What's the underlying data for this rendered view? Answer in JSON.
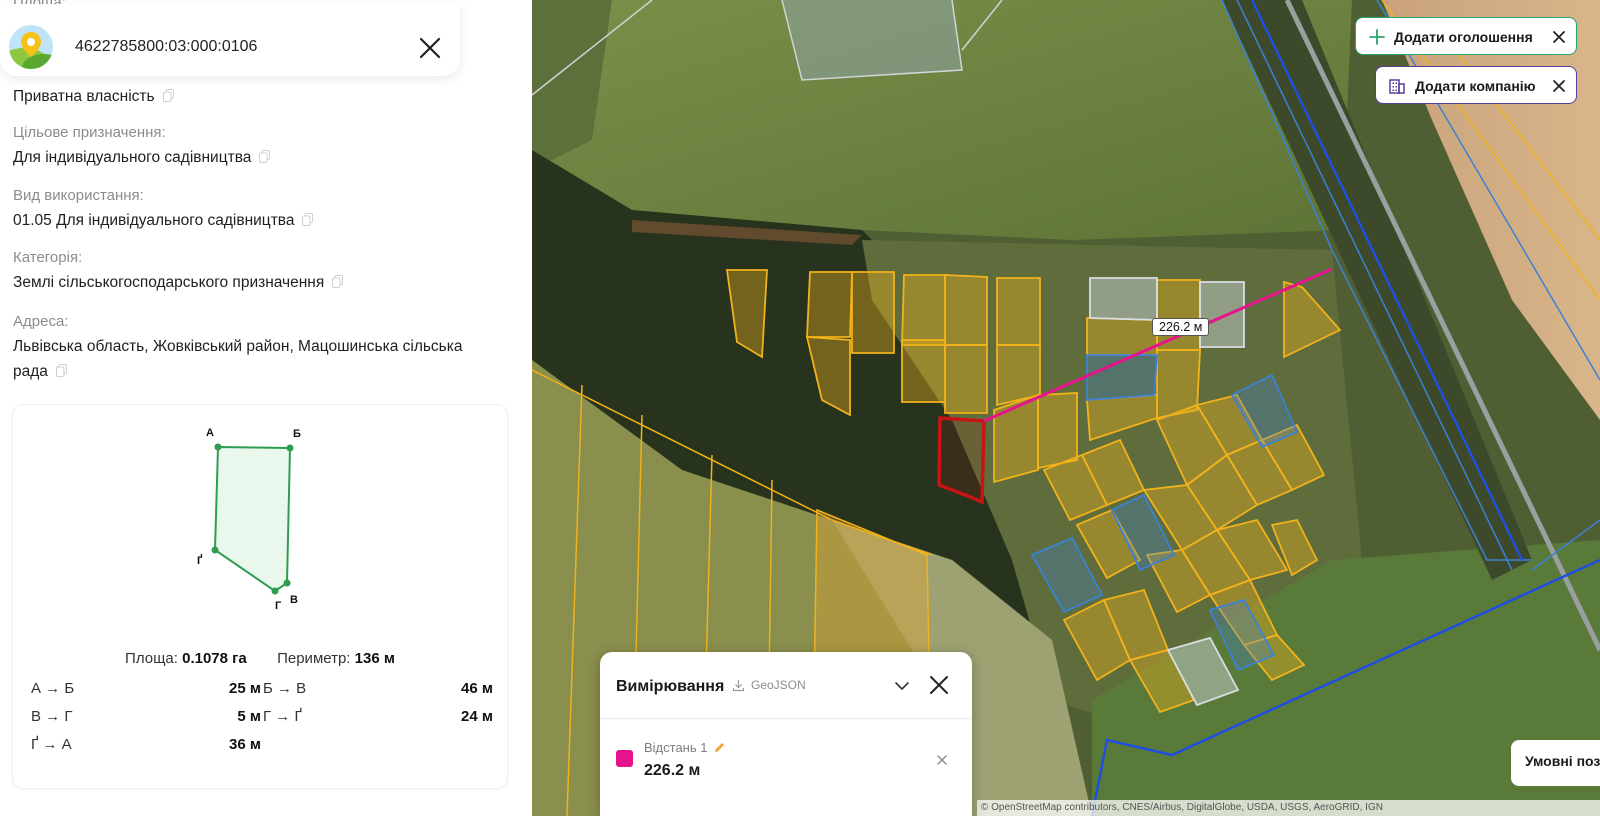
{
  "parcel": {
    "cut_label": "Площа:",
    "cadastral_number": "4622785800:03:000:0106"
  },
  "fields": {
    "ownership_value": "Приватна власність",
    "purpose_label": "Цільове призначення:",
    "purpose_value": "Для індивідуального садівництва",
    "usage_label": "Вид використання:",
    "usage_value": "01.05 Для індивідуального садівництва",
    "category_label": "Категорія:",
    "category_value": "Землі сільськогосподарського призначення",
    "address_label": "Адреса:",
    "address_line1": "Львівська область, Жовківський район, Мацошинська сільська",
    "address_line2": "рада"
  },
  "shape": {
    "vertices": [
      "А",
      "Б",
      "В",
      "Г",
      "Ґ"
    ],
    "area_label": "Площа:",
    "area_value": "0.1078 га",
    "perimeter_label": "Периметр:",
    "perimeter_value": "136 м",
    "edges": [
      {
        "label": "А → Б",
        "value": "25 м"
      },
      {
        "label": "Б → В",
        "value": "46 м"
      },
      {
        "label": "В → Г",
        "value": "5 м"
      },
      {
        "label": "Г → Ґ",
        "value": "24 м"
      },
      {
        "label": "Ґ → А",
        "value": "36 м"
      }
    ]
  },
  "map": {
    "add_listing": "Додати оголошення",
    "add_company": "Додати компанію",
    "distance_badge": "226.2 м",
    "smart_button": "Умовні поз",
    "attribution": "© OpenStreetMap contributors, CNES/Airbus, DigitalGlobe, USDA, USGS, AeroGRID, IGN"
  },
  "measurement": {
    "title": "Вимірювання",
    "geojson": "GeoJSON",
    "item_name": "Відстань 1",
    "item_value": "226.2 м"
  },
  "colors": {
    "measure_line": "#e6138c",
    "selected_parcel": "#c81414",
    "parcel_outline": "#f2b21b",
    "parcel_blue": "#3b82d6",
    "shape_stroke": "#2e9d4f",
    "listing_accent": "#2aa36a",
    "company_accent": "#5a3d9a"
  }
}
